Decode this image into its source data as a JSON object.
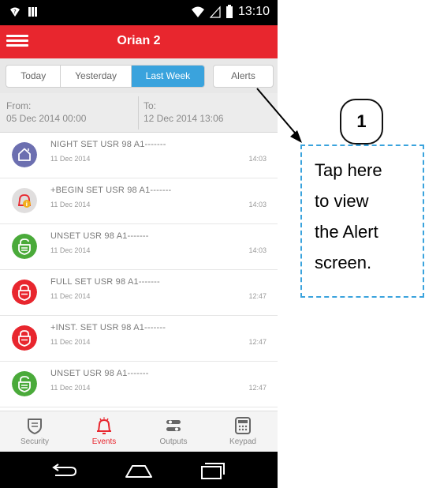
{
  "status_bar": {
    "time": "13:10"
  },
  "app": {
    "title": "Orian 2"
  },
  "tabs": [
    {
      "label": "Today",
      "active": false
    },
    {
      "label": "Yesterday",
      "active": false
    },
    {
      "label": "Last Week",
      "active": true
    }
  ],
  "alerts_button": {
    "label": "Alerts"
  },
  "range": {
    "from_label": "From:",
    "from_value": "05 Dec 2014  00:00",
    "to_label": "To:",
    "to_value": "12 Dec 2014  13:06"
  },
  "events": [
    {
      "title": "NIGHT SET USR 98 A1-------",
      "date": "11 Dec 2014",
      "time": "14:03",
      "icon": "home-icon",
      "color": "#6c6fb0"
    },
    {
      "title": "+BEGIN SET USR 98 A1-------",
      "date": "11 Dec 2014",
      "time": "14:03",
      "icon": "alarm-bell-icon",
      "color": "#e0dede"
    },
    {
      "title": "UNSET USR 98 A1-------",
      "date": "11 Dec 2014",
      "time": "14:03",
      "icon": "unlocked-shield-icon",
      "color": "#4aaa3a"
    },
    {
      "title": "FULL SET USR 98 A1-------",
      "date": "11 Dec 2014",
      "time": "12:47",
      "icon": "locked-shield-icon",
      "color": "#e8262e"
    },
    {
      "title": "+INST. SET USR 98 A1-------",
      "date": "11 Dec 2014",
      "time": "12:47",
      "icon": "locked-shield-icon",
      "color": "#e8262e"
    },
    {
      "title": "UNSET USR 98 A1-------",
      "date": "11 Dec 2014",
      "time": "12:47",
      "icon": "unlocked-shield-icon",
      "color": "#4aaa3a"
    }
  ],
  "bottom_nav": [
    {
      "label": "Security",
      "icon": "shield-icon",
      "active": false
    },
    {
      "label": "Events",
      "icon": "bell-icon",
      "active": true
    },
    {
      "label": "Outputs",
      "icon": "toggles-icon",
      "active": false
    },
    {
      "label": "Keypad",
      "icon": "keypad-icon",
      "active": false
    }
  ],
  "callout": {
    "number": "1",
    "lines": [
      "Tap here",
      "to view",
      "the Alert",
      "screen."
    ]
  },
  "colors": {
    "brand": "#e8262e",
    "active_tab": "#3aa3dd",
    "callout_border": "#3aa3dd"
  }
}
